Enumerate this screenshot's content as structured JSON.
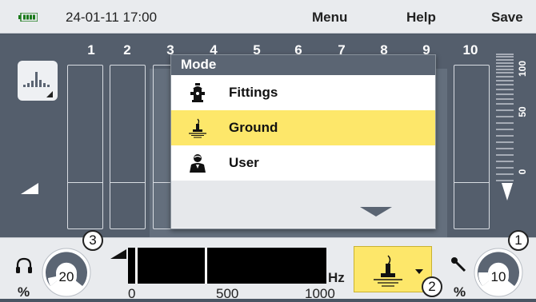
{
  "topbar": {
    "datetime": "24-01-11 17:00",
    "menu": "Menu",
    "help": "Help",
    "save": "Save"
  },
  "channels": [
    "1",
    "2",
    "3",
    "4",
    "5",
    "6",
    "7",
    "8",
    "9",
    "10"
  ],
  "scale": {
    "top": "100",
    "mid": "50",
    "bottom": "0"
  },
  "dialog": {
    "title": "Mode",
    "options": [
      {
        "label": "Fittings",
        "icon": "hydrant-icon",
        "selected": false
      },
      {
        "label": "Ground",
        "icon": "ground-microphone-icon",
        "selected": true
      },
      {
        "label": "User",
        "icon": "user-icon",
        "selected": false
      }
    ]
  },
  "bottom": {
    "left_knob_value": "20",
    "left_percent": "%",
    "left_badge": "3",
    "right_knob_value": "10",
    "right_percent": "%",
    "right_badge": "1",
    "mode_badge": "2",
    "spectrum_unit": "Hz",
    "spectrum_ticks": [
      "0",
      "500",
      "1000"
    ]
  },
  "colors": {
    "highlight": "#fde76a",
    "panel": "#545e6c",
    "bar_fill": "#fde76a"
  }
}
